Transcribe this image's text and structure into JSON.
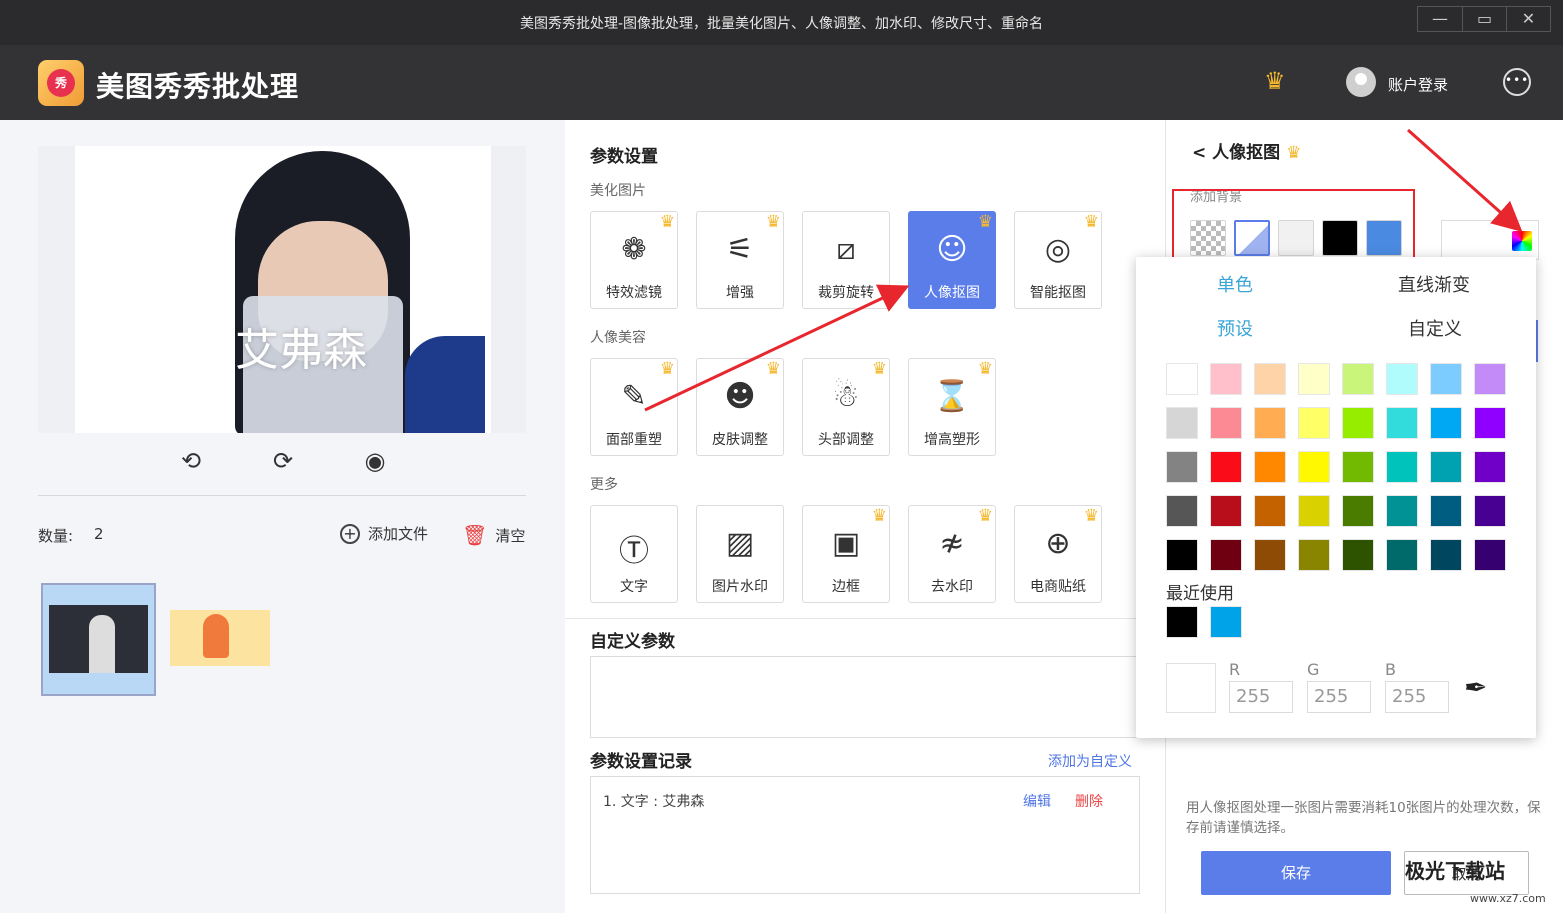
{
  "window": {
    "title": "美图秀秀批处理-图像批处理，批量美化图片、人像调整、加水印、修改尺寸、重命名",
    "minimize": "—",
    "maximize": "▭",
    "close": "✕"
  },
  "app": {
    "name": "美图秀秀批处理",
    "logo_text": "秀",
    "login_label": "账户登录",
    "more_label": "•••",
    "crown": "♛"
  },
  "preview": {
    "watermark_text": "艾弗森",
    "tools": [
      "⟲",
      "⟳",
      "◉"
    ]
  },
  "files": {
    "count_label": "数量:",
    "count": "2",
    "add_file_label": "添加文件",
    "add_icon": "+",
    "clear_label": "清空",
    "clear_icon": "🗑"
  },
  "params": {
    "title": "参数设置",
    "beautify_label": "美化图片",
    "beautify": [
      {
        "label": "特效滤镜",
        "icon": "❁"
      },
      {
        "label": "增强",
        "icon": "⚟"
      },
      {
        "label": "裁剪旋转",
        "icon": "⧄"
      },
      {
        "label": "人像抠图",
        "icon": "☺"
      },
      {
        "label": "智能抠图",
        "icon": "◎"
      }
    ],
    "portrait_label": "人像美容",
    "portrait": [
      {
        "label": "面部重塑",
        "icon": "✎"
      },
      {
        "label": "皮肤调整",
        "icon": "☻"
      },
      {
        "label": "头部调整",
        "icon": "☃"
      },
      {
        "label": "增高塑形",
        "icon": "⌛"
      }
    ],
    "more_label": "更多",
    "more": [
      {
        "label": "文字",
        "icon": "Ⓣ"
      },
      {
        "label": "图片水印",
        "icon": "▨"
      },
      {
        "label": "边框",
        "icon": "▣"
      },
      {
        "label": "去水印",
        "icon": "≉"
      },
      {
        "label": "电商贴纸",
        "icon": "⊕"
      }
    ],
    "crown": "♛"
  },
  "custom": {
    "title": "自定义参数"
  },
  "records": {
    "title": "参数设置记录",
    "add_custom": "添加为自定义",
    "items": [
      {
        "text": "1.  文字 : 艾弗森",
        "edit": "编辑",
        "delete": "删除"
      }
    ]
  },
  "portrait_cutout": {
    "title": "< 人像抠图",
    "crown": "♛",
    "bg_label": "添加背景",
    "note": "用人像抠图处理一张图片需要消耗10张图片的处理次数，保存前请谨慎选择。",
    "save_label": "保存",
    "cancel_label": "取消"
  },
  "color_picker": {
    "tabs": {
      "solid": "单色",
      "gradient": "直线渐变",
      "preset": "预设",
      "custom": "自定义"
    },
    "colors": [
      "#ffffff",
      "#ffc0cb",
      "#ffd3a8",
      "#ffffc8",
      "#c8f57a",
      "#b0fcfc",
      "#7cccff",
      "#c38bf7",
      "#d6d6d6",
      "#fb8a94",
      "#ffac52",
      "#ffff66",
      "#96ed00",
      "#33dcdc",
      "#00a8f3",
      "#9000ff",
      "#838383",
      "#fa0c18",
      "#ff8800",
      "#fff800",
      "#72ba01",
      "#00c3bb",
      "#00a2b1",
      "#7000c8",
      "#565656",
      "#b80d1b",
      "#c56200",
      "#d9d200",
      "#4a7c00",
      "#009294",
      "#005d82",
      "#480092",
      "#000000",
      "#6e0012",
      "#8d4b05",
      "#8a8500",
      "#2d5200",
      "#006a6a",
      "#00465e",
      "#360070"
    ],
    "recent_label": "最近使用",
    "recent": [
      "#000000",
      "#00a2e8"
    ],
    "r_label": "R",
    "g_label": "G",
    "b_label": "B",
    "r": "255",
    "g": "255",
    "b": "255",
    "dropper_icon": "✒"
  },
  "watermark_site": {
    "logo": "极光下载站",
    "url": "www.xz7.com"
  }
}
